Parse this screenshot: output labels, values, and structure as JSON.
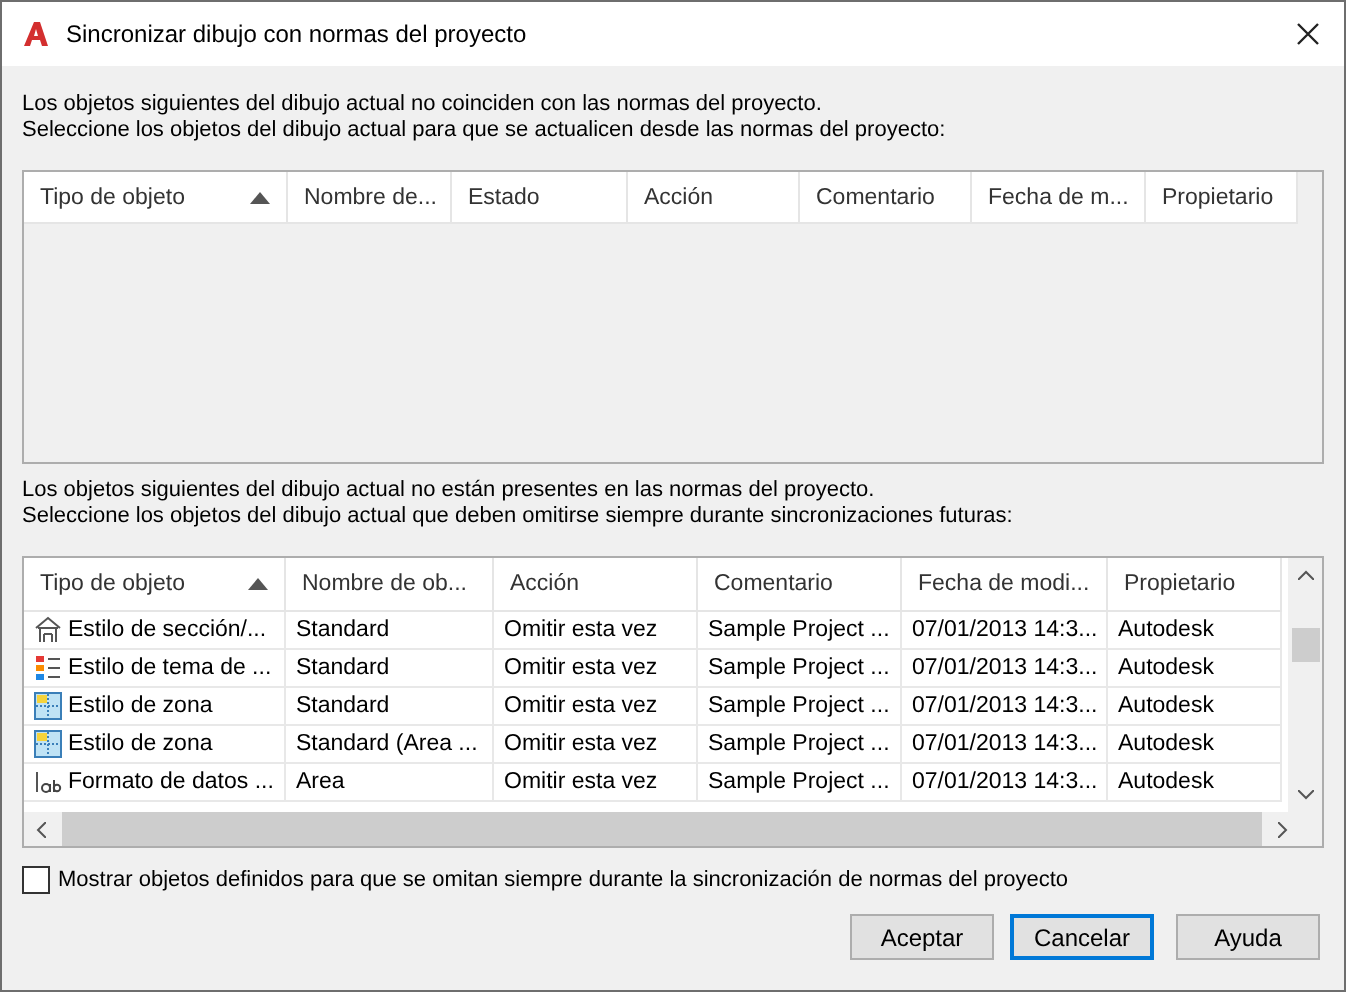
{
  "window": {
    "title": "Sincronizar dibujo con normas del proyecto"
  },
  "section_1": {
    "lines": [
      "Los objetos siguientes del dibujo actual no coinciden con las normas del proyecto.",
      "Seleccione los objetos del dibujo actual para que se actualicen desde las normas del proyecto:"
    ],
    "table": {
      "columns": [
        {
          "label": "Tipo de objeto",
          "sorted": true
        },
        {
          "label": "Nombre de..."
        },
        {
          "label": "Estado"
        },
        {
          "label": "Acción"
        },
        {
          "label": "Comentario"
        },
        {
          "label": "Fecha de m..."
        },
        {
          "label": "Propietario"
        }
      ]
    }
  },
  "section_2": {
    "lines": [
      "Los objetos siguientes del dibujo actual no están presentes en las normas del proyecto.",
      "Seleccione los objetos del dibujo actual que deben omitirse siempre durante sincronizaciones futuras:"
    ],
    "table": {
      "columns": [
        {
          "label": "Tipo de objeto",
          "sorted": true
        },
        {
          "label": "Nombre de ob..."
        },
        {
          "label": "Acción"
        },
        {
          "label": "Comentario"
        },
        {
          "label": "Fecha de modi..."
        },
        {
          "label": "Propietario"
        }
      ],
      "rows": [
        {
          "kind": "section",
          "cells": [
            "Estilo de sección/...",
            "Standard",
            "Omitir esta vez",
            "Sample Project ...",
            "07/01/2013 14:3...",
            "Autodesk"
          ]
        },
        {
          "kind": "theme",
          "cells": [
            "Estilo de tema de ...",
            "Standard",
            "Omitir esta vez",
            "Sample Project ...",
            "07/01/2013 14:3...",
            "Autodesk"
          ]
        },
        {
          "kind": "zone",
          "cells": [
            "Estilo de zona",
            "Standard",
            "Omitir esta vez",
            "Sample Project ...",
            "07/01/2013 14:3...",
            "Autodesk"
          ]
        },
        {
          "kind": "zone",
          "cells": [
            "Estilo de zona",
            "Standard (Area ...",
            "Omitir esta vez",
            "Sample Project ...",
            "07/01/2013 14:3...",
            "Autodesk"
          ]
        },
        {
          "kind": "data-format",
          "cells": [
            "Formato de datos ...",
            "Area",
            "Omitir esta vez",
            "Sample Project ...",
            "07/01/2013 14:3...",
            "Autodesk"
          ]
        }
      ]
    }
  },
  "show_ignored": {
    "label": "Mostrar objetos definidos para que se omitan siempre durante la sincronización de normas del proyecto",
    "checked": false
  },
  "buttons": [
    {
      "label": "Aceptar",
      "focused": false
    },
    {
      "label": "Cancelar",
      "focused": true
    },
    {
      "label": "Ayuda",
      "focused": false
    }
  ]
}
